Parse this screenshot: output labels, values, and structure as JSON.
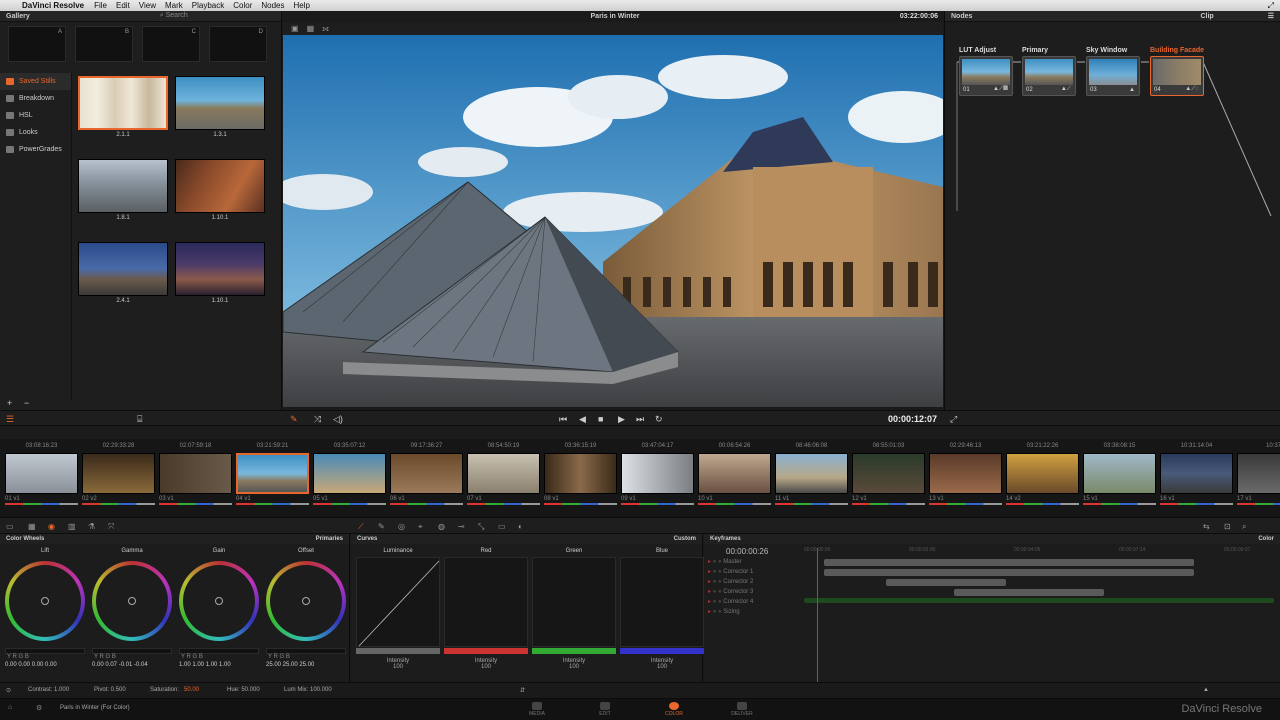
{
  "menubar": {
    "apple": "",
    "app": "DaVinci Resolve",
    "items": [
      "File",
      "Edit",
      "View",
      "Mark",
      "Playback",
      "Color",
      "Nodes",
      "Help"
    ]
  },
  "gallery": {
    "title": "Gallery",
    "search": "Search",
    "memories": [
      "A",
      "B",
      "C",
      "D"
    ],
    "albums": [
      "Saved Stills",
      "Breakdown",
      "HSL",
      "Looks",
      "PowerGrades"
    ],
    "stills": [
      "2.1.1",
      "1.3.1",
      "1.8.1",
      "1.10.1",
      "2.4.1",
      "1.10.1"
    ],
    "add": "+",
    "remove": "−"
  },
  "viewer": {
    "title": "Paris in Winter",
    "timecode_top": "03:22:00:06",
    "timecode": "00:00:12:07"
  },
  "nodes": {
    "title": "Nodes",
    "clip_label": "Clip",
    "items": [
      {
        "label": "LUT Adjust",
        "num": "01"
      },
      {
        "label": "Primary",
        "num": "02"
      },
      {
        "label": "Sky Window",
        "num": "03"
      },
      {
        "label": "Building Facade",
        "num": "04"
      }
    ]
  },
  "clips": {
    "timecodes": [
      "03:08:16:23",
      "02:29:33:28",
      "02:07:59:18",
      "03:21:59:21",
      "03:35:07:12",
      "09:17:36:27",
      "08:54:50:19",
      "03:36:15:19",
      "03:47:04:17",
      "00:06:54:26",
      "08:46:06:08",
      "08:55:01:03",
      "02:29:46:13",
      "03:21:22:26",
      "03:38:08:15",
      "10:31:14:04",
      "10:37"
    ],
    "labels": [
      "01 v1",
      "02 v2",
      "03 v1",
      "04 v1",
      "05 v1",
      "06 v1",
      "07 v1",
      "08 v1",
      "09 v1",
      "10 v1",
      "11 v1",
      "12 v1",
      "13 v1",
      "14 v2",
      "15 v1",
      "16 v1",
      "17 v1"
    ]
  },
  "color_wheels": {
    "title": "Color Wheels",
    "mode": "Primaries",
    "wheels": [
      {
        "label": "Lift",
        "values": "0.00  0.00  0.00  0.00"
      },
      {
        "label": "Gamma",
        "values": "0.00  0.07  -0.01  -0.04"
      },
      {
        "label": "Gain",
        "values": "1.00  1.00  1.00  1.00"
      },
      {
        "label": "Offset",
        "values": "25.00  25.00  25.00"
      }
    ],
    "channels": "Y      R      G      B",
    "contrast": "Contrast: 1.000",
    "pivot": "Pivot: 0.500",
    "saturation_label": "Saturation:",
    "saturation_value": "50.00",
    "hue": "Hue: 50.000",
    "lummix": "Lum Mix: 100.000"
  },
  "curves": {
    "title": "Curves",
    "mode": "Custom",
    "channels": [
      {
        "label": "Luminance",
        "intensity": "Intensity",
        "value": "100"
      },
      {
        "label": "Red",
        "intensity": "Intensity",
        "value": "100"
      },
      {
        "label": "Green",
        "intensity": "Intensity",
        "value": "100"
      },
      {
        "label": "Blue",
        "intensity": "Intensity",
        "value": "100"
      }
    ]
  },
  "keyframes": {
    "title": "Keyframes",
    "mode": "Color",
    "timecode": "00:00:00:26",
    "ruler": [
      "00:00:00:00",
      "00:00:02:00",
      "00:00:04:06",
      "00:00:07:14",
      "00:00:09:07"
    ],
    "rows": [
      "Master",
      "Corrector 1",
      "Corrector 2",
      "Corrector 3",
      "Corrector 4",
      "Sizing"
    ]
  },
  "status": {
    "project": "Paris in Winter (For Color)"
  },
  "pages": [
    "MEDIA",
    "EDIT",
    "COLOR",
    "DELIVER"
  ],
  "brand": "DaVinci Resolve"
}
